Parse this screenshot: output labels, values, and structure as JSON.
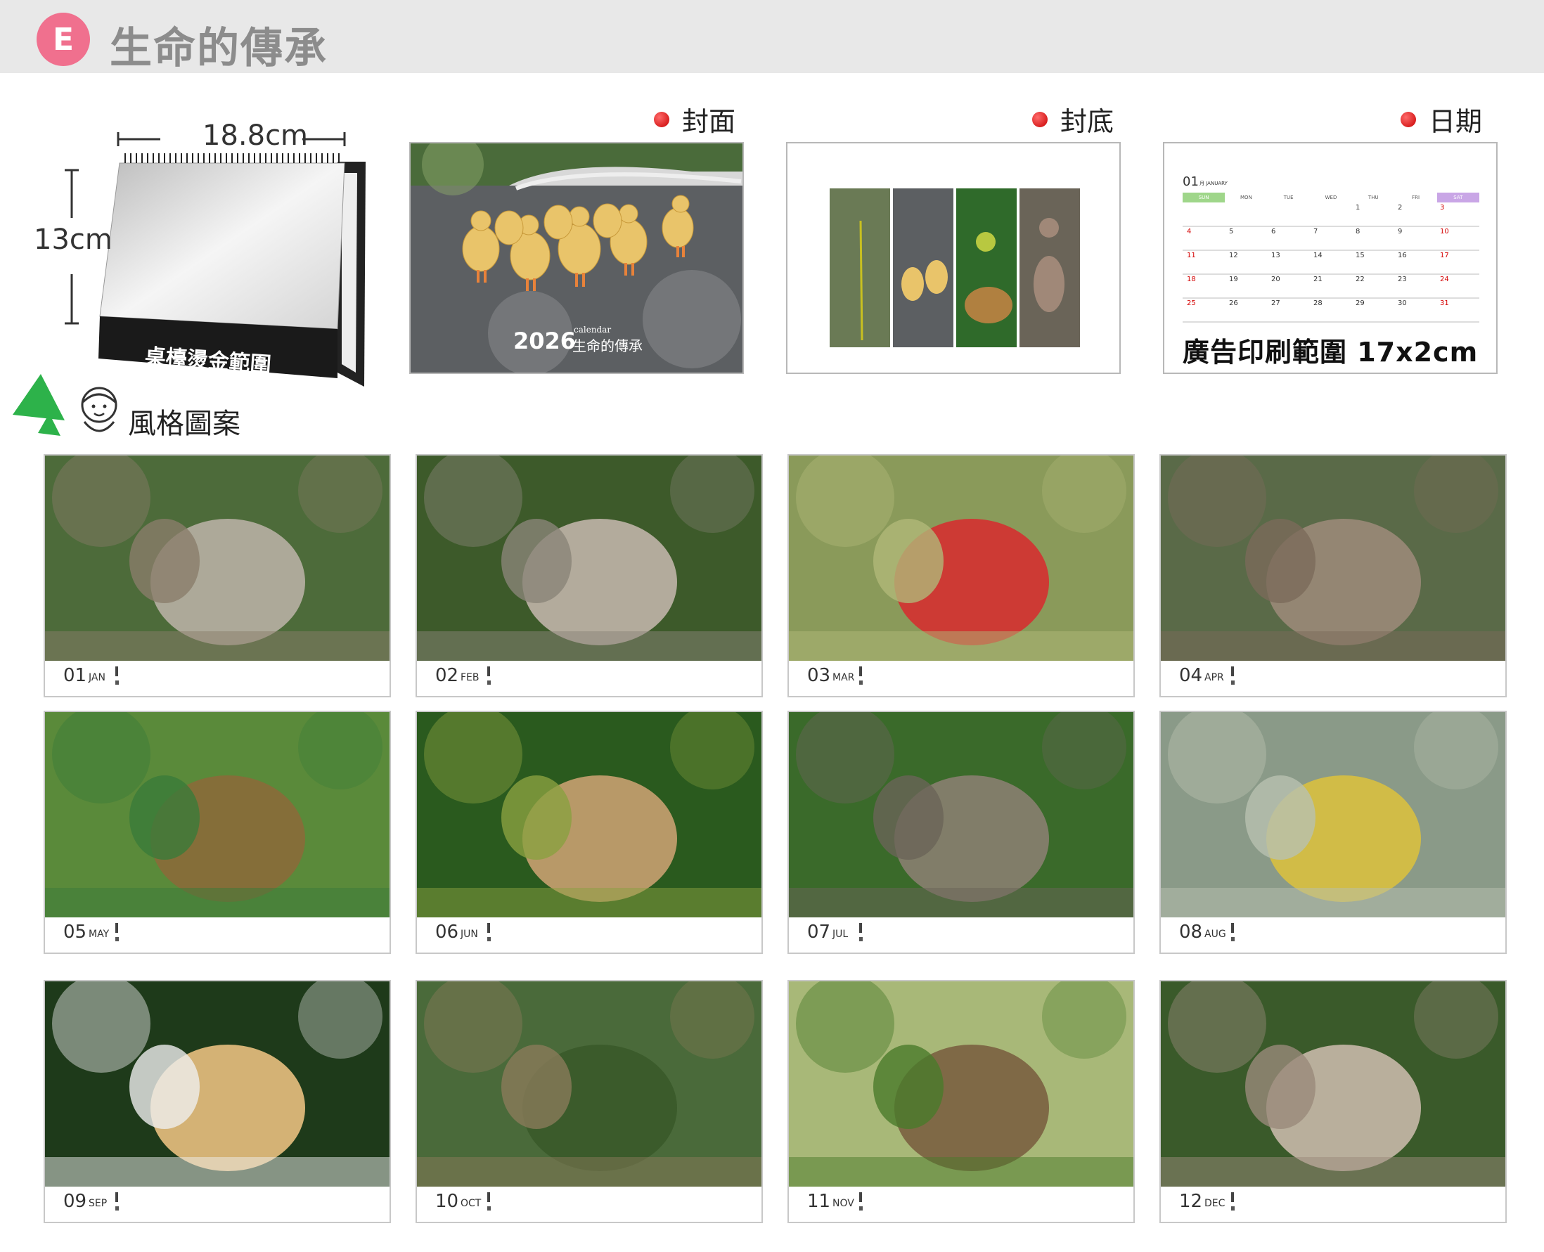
{
  "header": {
    "badge": "E",
    "title": "生命的傳承"
  },
  "product": {
    "width_label": "18.8cm",
    "height_label": "13cm",
    "gold_area_label": "桌檯燙金範圍"
  },
  "sections": {
    "cover": "封面",
    "back": "封底",
    "date": "日期"
  },
  "cover": {
    "year": "2026",
    "calendar_word": "calendar",
    "title": "生命的傳承"
  },
  "date_page": {
    "month_num": "01",
    "month_label": "月 JANUARY",
    "weekdays": [
      "SUN",
      "MON",
      "TUE",
      "WED",
      "THU",
      "FRI",
      "SAT"
    ],
    "ad_text": "廣告印刷範圍 17x2cm"
  },
  "style_label": "風格圖案",
  "months": [
    {
      "num": "01",
      "name": "JAN"
    },
    {
      "num": "02",
      "name": "FEB"
    },
    {
      "num": "03",
      "name": "MAR"
    },
    {
      "num": "04",
      "name": "APR"
    },
    {
      "num": "05",
      "name": "MAY"
    },
    {
      "num": "06",
      "name": "JUN"
    },
    {
      "num": "07",
      "name": "JUL"
    },
    {
      "num": "08",
      "name": "AUG"
    },
    {
      "num": "09",
      "name": "SEP"
    },
    {
      "num": "10",
      "name": "OCT"
    },
    {
      "num": "11",
      "name": "NOV"
    },
    {
      "num": "12",
      "name": "DEC"
    }
  ],
  "colors": {
    "badge": "#f0708e",
    "header_bg": "#e8e8e8",
    "accent_red": "#d40000",
    "sat_header": "#c9a6e6",
    "sun_header": "#9fd68a"
  }
}
